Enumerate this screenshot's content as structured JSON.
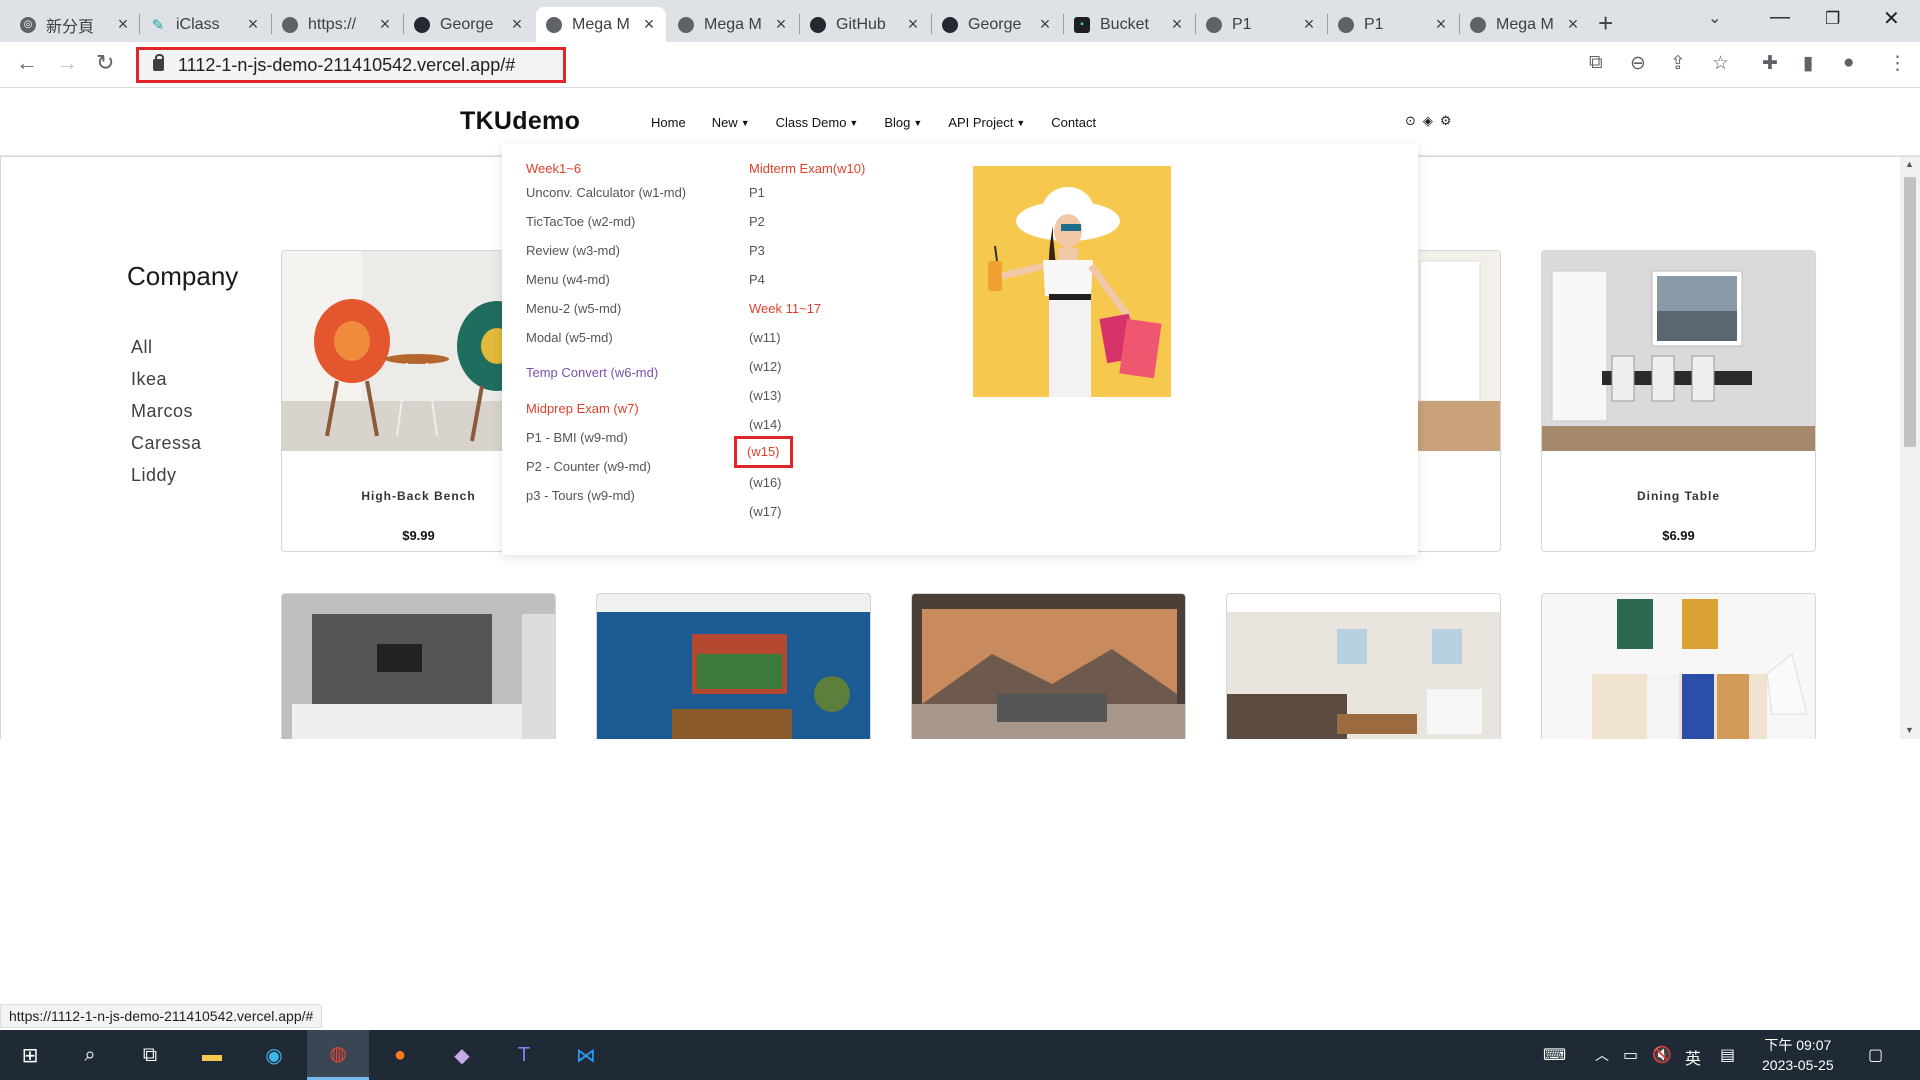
{
  "browser": {
    "tabs": [
      {
        "title": "新分頁",
        "icon": "chrome-icon"
      },
      {
        "title": "iClass",
        "icon": "iclass-icon"
      },
      {
        "title": "https://",
        "icon": "globe-icon"
      },
      {
        "title": "George",
        "icon": "github-icon"
      },
      {
        "title": "Mega M",
        "icon": "globe-icon",
        "active": true
      },
      {
        "title": "Mega M",
        "icon": "globe-icon"
      },
      {
        "title": "GitHub",
        "icon": "github-icon"
      },
      {
        "title": "George",
        "icon": "github-icon"
      },
      {
        "title": "Bucket",
        "icon": "bucket-icon"
      },
      {
        "title": "P1",
        "icon": "globe-icon"
      },
      {
        "title": "P1",
        "icon": "globe-icon"
      },
      {
        "title": "Mega M",
        "icon": "globe-icon"
      }
    ],
    "url": "1112-1-n-js-demo-211410542.vercel.app/#",
    "status_url": "https://1112-1-n-js-demo-211410542.vercel.app/#"
  },
  "site": {
    "brand": "TKUdemo",
    "nav": [
      {
        "label": "Home",
        "caret": false
      },
      {
        "label": "New",
        "caret": true
      },
      {
        "label": "Class Demo",
        "caret": true,
        "active": true
      },
      {
        "label": "Blog",
        "caret": true
      },
      {
        "label": "API Project",
        "caret": true
      },
      {
        "label": "Contact",
        "caret": false
      }
    ],
    "nav_icons": [
      "github-icon",
      "diamond-icon",
      "gear-icon"
    ]
  },
  "mega_menu": {
    "col1": [
      {
        "text": "Week1~6",
        "type": "header"
      },
      {
        "text": "Unconv. Calculator (w1-md)",
        "type": "item"
      },
      {
        "text": "TicTacToe (w2-md)",
        "type": "item"
      },
      {
        "text": "Review (w3-md)",
        "type": "item"
      },
      {
        "text": "Menu (w4-md)",
        "type": "item"
      },
      {
        "text": "Menu-2 (w5-md)",
        "type": "item"
      },
      {
        "text": "Modal (w5-md)",
        "type": "item"
      },
      {
        "text": "Temp Convert (w6-md)",
        "type": "header-purple"
      },
      {
        "text": "Midprep Exam (w7)",
        "type": "header"
      },
      {
        "text": "P1 - BMI (w9-md)",
        "type": "item"
      },
      {
        "text": "P2 - Counter (w9-md)",
        "type": "item"
      },
      {
        "text": "p3 - Tours (w9-md)",
        "type": "item"
      }
    ],
    "col2": [
      {
        "text": "Midterm Exam(w10)",
        "type": "header"
      },
      {
        "text": "P1",
        "type": "item"
      },
      {
        "text": "P2",
        "type": "item"
      },
      {
        "text": "P3",
        "type": "item"
      },
      {
        "text": "P4",
        "type": "item"
      },
      {
        "text": "Week 11~17",
        "type": "header"
      },
      {
        "text": "(w11)",
        "type": "item"
      },
      {
        "text": "(w12)",
        "type": "item"
      },
      {
        "text": "(w13)",
        "type": "item"
      },
      {
        "text": "(w14)",
        "type": "item"
      },
      {
        "text": "(w15)",
        "type": "item",
        "highlight": true
      },
      {
        "text": "(w16)",
        "type": "item"
      },
      {
        "text": "(w17)",
        "type": "item"
      }
    ]
  },
  "sidebar": {
    "title": "Company",
    "items": [
      "All",
      "Ikea",
      "Marcos",
      "Caressa",
      "Liddy"
    ]
  },
  "products": [
    {
      "name": "High-Back Bench",
      "price": "$9.99"
    },
    {
      "name": "Dining Table",
      "price": "$6.99"
    }
  ],
  "taskbar": {
    "ime": "英",
    "clock_time": "下午 09:07",
    "clock_date": "2023-05-25"
  },
  "colors": {
    "accent": "#e03f2b",
    "highlight_box": "#e0262b",
    "purple": "#7b52ab",
    "taskbar": "#1f2a36"
  }
}
